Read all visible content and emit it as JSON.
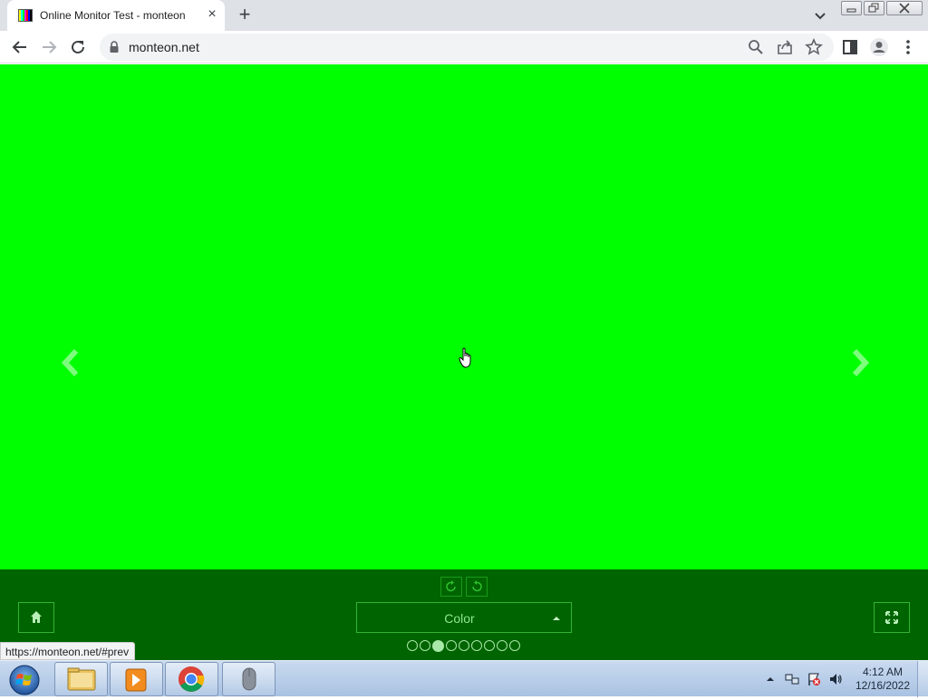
{
  "browser": {
    "tab_title": "Online Monitor Test - monteon",
    "url": "monteon.net",
    "status_url": "https://monteon.net/#prev"
  },
  "test": {
    "screen_color": "#00ff00",
    "panel_color": "#006400",
    "mode_label": "Color",
    "pages_total": 9,
    "active_page": 3
  },
  "taskbar": {
    "time": "4:12 AM",
    "date": "12/16/2022",
    "apps": [
      "windows-explorer",
      "media-player",
      "google-chrome",
      "mouse-app"
    ]
  }
}
